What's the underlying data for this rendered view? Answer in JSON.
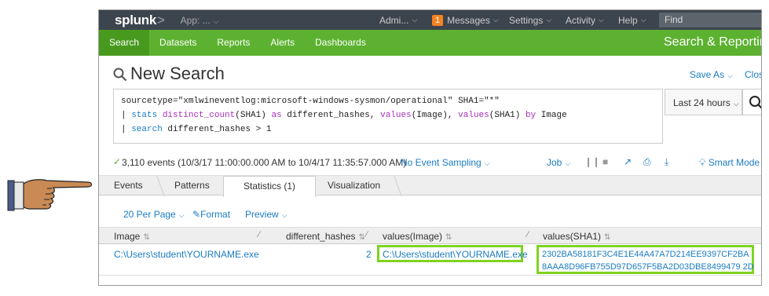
{
  "topbar": {
    "logo": "splunk",
    "logo_suffix": ">",
    "app_menu": "App: ...",
    "admin_menu": "Admi...",
    "messages_count": "1",
    "messages_menu": "Messages",
    "settings_menu": "Settings",
    "activity_menu": "Activity",
    "help_menu": "Help",
    "find_placeholder": "Find"
  },
  "navbar": {
    "items": [
      "Search",
      "Datasets",
      "Reports",
      "Alerts",
      "Dashboards"
    ],
    "active": "Search",
    "app_title": "Search & Reporting"
  },
  "search": {
    "title": "New Search",
    "save_as": "Save As",
    "close": "Close",
    "query_line1": "sourcetype=\"xmlwineventlog:microsoft-windows-sysmon/operational\" SHA1=\"*\"",
    "query_line2_pipe": "| ",
    "query_line2_cmd": "stats",
    "query_line2_fn1": "distinct_count",
    "query_line2_a": "(SHA1) ",
    "query_line2_as": "as",
    "query_line2_b": " different_hashes, ",
    "query_line2_fn2": "values",
    "query_line2_c": "(Image), ",
    "query_line2_fn3": "values",
    "query_line2_d": "(SHA1) ",
    "query_line2_by": "by",
    "query_line2_e": " Image",
    "query_line3_pipe": "| ",
    "query_line3_cmd": "search",
    "query_line3_rest": " different_hashes > 1",
    "time_range": "Last 24 hours"
  },
  "status": {
    "events_text": "3,110 events (10/3/17 11:00:00.000 AM to 10/4/17 11:35:57.000 AM)",
    "sampling": "No Event Sampling",
    "job": "Job",
    "mode": "Smart Mode"
  },
  "tabs": [
    "Events",
    "Patterns",
    "Statistics (1)",
    "Visualization"
  ],
  "active_tab": "Statistics (1)",
  "options": {
    "per_page": "20 Per Page",
    "format": "Format",
    "preview": "Preview"
  },
  "table": {
    "columns": [
      "Image",
      "different_hashes",
      "values(Image)",
      "values(SHA1)"
    ],
    "rows": [
      {
        "image": "C:\\Users\\student\\YOURNAME.exe",
        "different_hashes": "2",
        "values_image": "C:\\Users\\student\\YOURNAME.exe",
        "sha1_1": "2302BA58181F3C4E1E44A47A7D214EE9397CF2BA",
        "sha1_2": "8AAA8D96FB755D97D657F5BA2D03DBE8499479 2D"
      }
    ]
  },
  "colors": {
    "nav_green": "#5cb230",
    "topbar": "#3c444d",
    "link_blue": "#1a7cc2",
    "highlight_green": "#7ed321"
  }
}
